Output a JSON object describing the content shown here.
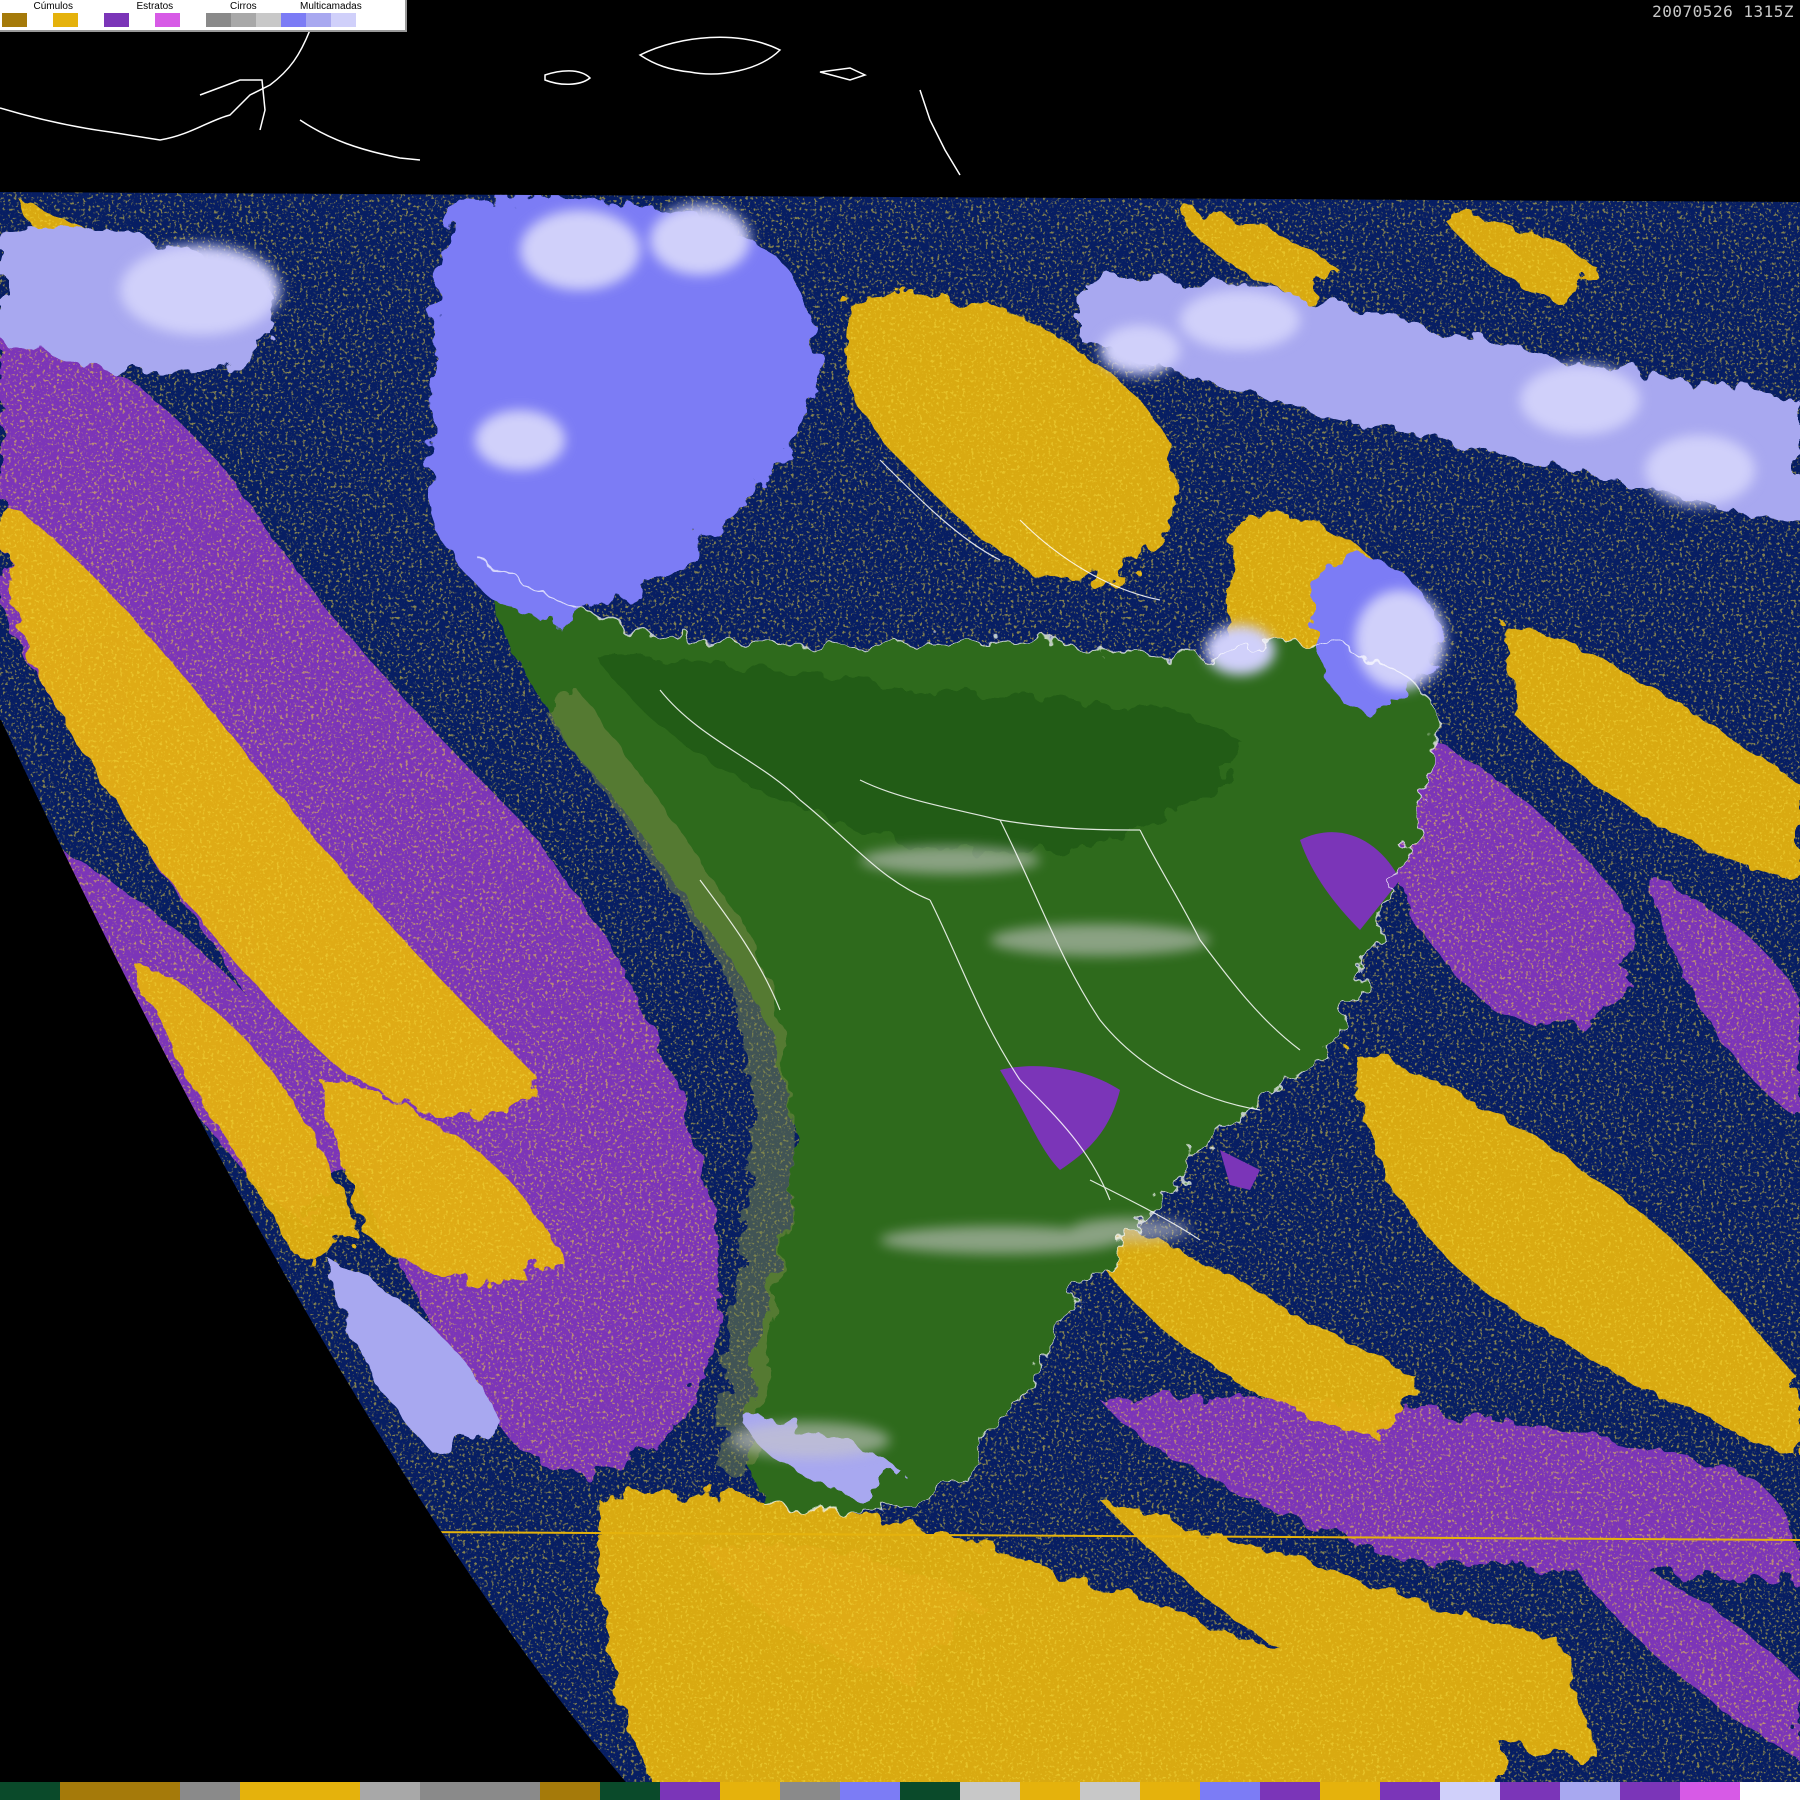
{
  "legend": {
    "groups": [
      {
        "label": "Cúmulos",
        "colors": [
          "#a57a0a",
          "#e5b20c"
        ]
      },
      {
        "label": "Estratos",
        "colors": [
          "#7b35b8",
          "#d75ae6"
        ]
      },
      {
        "label": "Cirros",
        "colors": [
          "#8a8a8a",
          "#a8a8a8",
          "#c8c8c8"
        ]
      },
      {
        "label": "Multicamadas",
        "colors": [
          "#7c7cf5",
          "#a8a8f0",
          "#d0d0fa",
          "#ffffff"
        ]
      }
    ]
  },
  "timestamp": "20070526 1315Z",
  "colors": {
    "ocean": "#071e63",
    "land": "#2f6b1d",
    "land_dark": "#205c12",
    "cumulus_dark": "#a57a0a",
    "cumulus": "#e5b20c",
    "stratus": "#7b35b8",
    "stratus_light": "#d75ae6",
    "cirrus": "#a8a8a8",
    "multilayer": "#7c7cf5",
    "multilayer_light": "#d0d0fa",
    "border": "#ffffff"
  },
  "bottom_bar_colors": [
    "#0a4a2a",
    "#a57a0a",
    "#a57a0a",
    "#8a8a8a",
    "#e5b20c",
    "#e5b20c",
    "#a8a8a8",
    "#8a8a8a",
    "#8a8a8a",
    "#a57a0a",
    "#0a4a2a",
    "#7b35b8",
    "#e5b20c",
    "#8a8a8a",
    "#7c7cf5",
    "#0a4a2a",
    "#c8c8c8",
    "#e5b20c",
    "#c8c8c8",
    "#e5b20c",
    "#7c7cf5",
    "#7b35b8",
    "#e5b20c",
    "#7b35b8",
    "#d0d0fa",
    "#7b35b8",
    "#a8a8f0",
    "#7b35b8",
    "#d75ae6",
    "#ffffff"
  ]
}
